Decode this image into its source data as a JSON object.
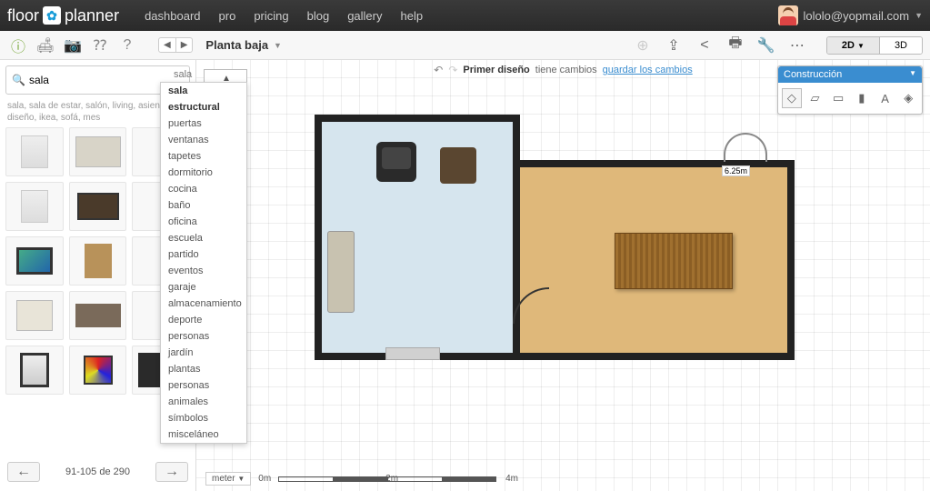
{
  "brand": {
    "w1": "floor",
    "w2": "planner"
  },
  "nav": {
    "dashboard": "dashboard",
    "pro": "pro",
    "pricing": "pricing",
    "blog": "blog",
    "gallery": "gallery",
    "help": "help"
  },
  "user": {
    "email": "lololo@yopmail.com"
  },
  "floor": {
    "name": "Planta baja"
  },
  "viewtabs": {
    "v2d": "2D",
    "v3d": "3D"
  },
  "search": {
    "value": "sala",
    "category": "sala",
    "hint": "sala, sala de estar, salón, living, asientos, diseño, ikea, sofá, mes"
  },
  "categories": [
    "sala",
    "estructural",
    "puertas",
    "ventanas",
    "tapetes",
    "dormitorio",
    "cocina",
    "baño",
    "oficina",
    "escuela",
    "partido",
    "eventos",
    "garaje",
    "almacenamiento",
    "deporte",
    "personas",
    "jardín",
    "plantas",
    "personas",
    "animales",
    "símbolos",
    "misceláneo"
  ],
  "pager": {
    "text": "91-105 de 290"
  },
  "status": {
    "title": "Primer diseño",
    "changes": "tiene cambios",
    "save": "guardar los cambios"
  },
  "construction": {
    "title": "Construcción"
  },
  "door_label": "6.25m",
  "scale": {
    "unit": "meter",
    "t0": "0m",
    "t2": "2m",
    "t4": "4m"
  },
  "zoom": {
    "plus": "+",
    "mid": "┼",
    "minus": "−"
  }
}
